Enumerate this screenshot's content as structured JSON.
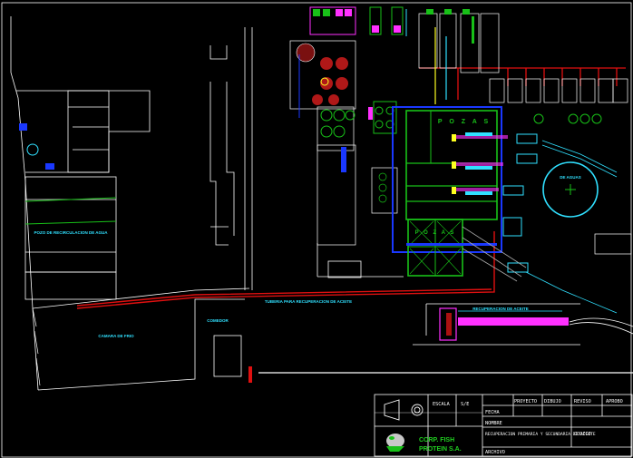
{
  "labels": {
    "pozas_top": "P O Z A S",
    "pozas_bottom": "P O Z A S",
    "pozo_recirculacion": "POZO DE RECIRCULACION DE AGUA",
    "tuberia_recuperacion": "TUBERIA PARA RECUPERACION DE ACEITE",
    "camara_frio": "CAMARA DE FRIO",
    "comedor": "COMEDOR",
    "tanque_aceite": "RECUPERACION DE ACEITE",
    "de_aguas": "DE AGUAS"
  },
  "title_block": {
    "escala_label": "ESCALA",
    "escala_value": "S/E",
    "proyecto": "PROYECTO",
    "dibujo": "DIBUJO",
    "reviso": "REVISO",
    "aprobo": "APROBO",
    "fecha": "FECHA",
    "nombre": "NOMBRE",
    "descripcion": "RECUPERACION PRIMARIA Y SECUNDARIA DE ACEITE",
    "codigo": "CODIGO",
    "archivo": "ARCHIVO",
    "empresa_line1": "CORP. FISH",
    "empresa_line2": "PROTEIN S.A."
  },
  "colors": {
    "background": "#000000",
    "lines": "#ffffff",
    "pipe_red": "#e01010",
    "green": "#18c018",
    "blue": "#1a38ff",
    "magenta": "#ff30ff",
    "cyan": "#30e0ff",
    "yellow": "#ffff20",
    "title_text": "#20d020"
  }
}
